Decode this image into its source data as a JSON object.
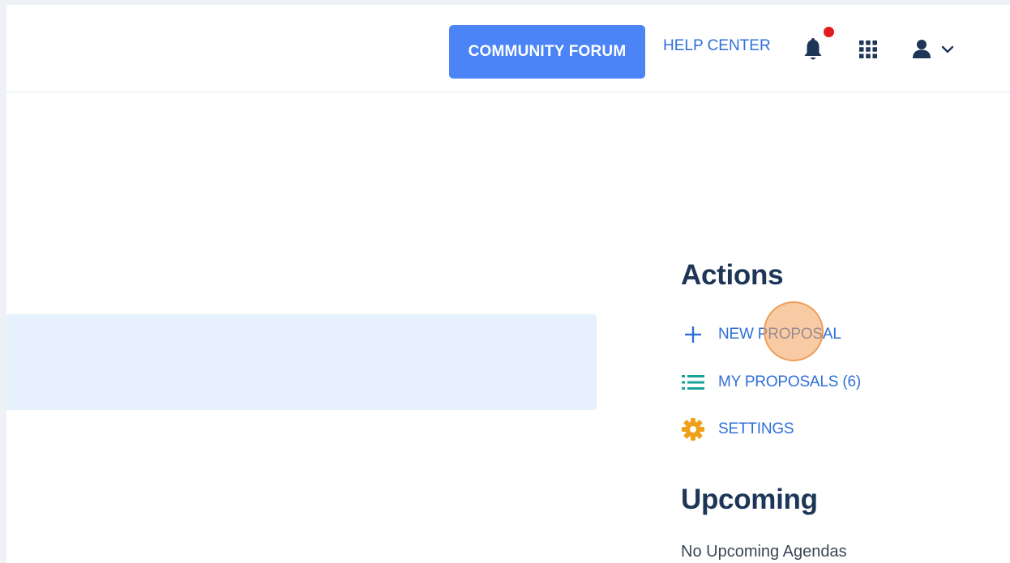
{
  "header": {
    "forum_button_label": "COMMUNITY FORUM",
    "help_center_label": "HELP CENTER",
    "icons": [
      "bell-icon",
      "apps-grid-icon",
      "user-icon",
      "chevron-down-icon"
    ],
    "has_notification": true
  },
  "sidebar": {
    "actions_heading": "Actions",
    "actions": [
      {
        "label": "NEW PROPOSAL",
        "icon": "plus-icon",
        "color": "#2f6fd8"
      },
      {
        "label": "MY PROPOSALS (6)",
        "icon": "list-icon",
        "color": "#1aa39a"
      },
      {
        "label": "SETTINGS",
        "icon": "gear-icon",
        "color": "#f0a11a"
      }
    ],
    "upcoming_heading": "Upcoming",
    "upcoming_empty_text": "No Upcoming Agendas"
  },
  "colors": {
    "accent": "#4a84f6",
    "link": "#2f6fd8",
    "heading": "#1d3557",
    "notification": "#e01c1c",
    "highlight": "#e6f1fd"
  }
}
